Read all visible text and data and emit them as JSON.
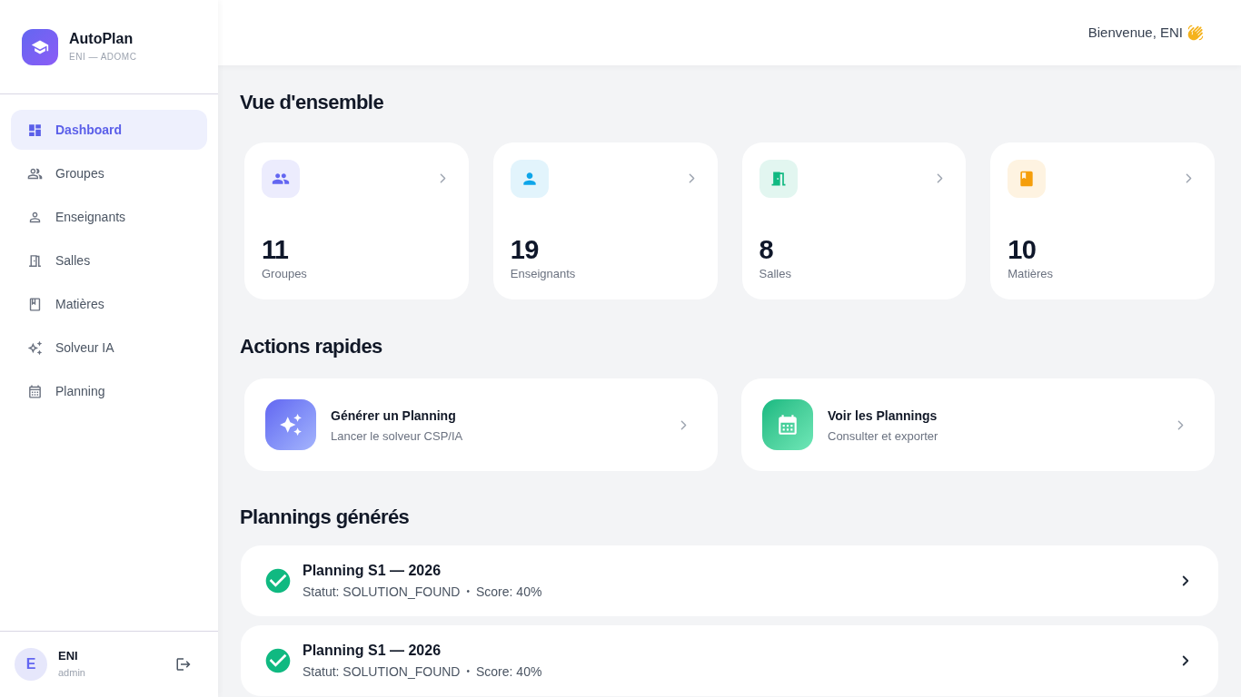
{
  "sidebar": {
    "brand": {
      "name": "AutoPlan",
      "subtitle": "ENI — ADOMC"
    },
    "nav_items": [
      {
        "label": "Dashboard",
        "selected": true
      },
      {
        "label": "Groupes",
        "selected": false
      },
      {
        "label": "Enseignants",
        "selected": false
      },
      {
        "label": "Salles",
        "selected": false
      },
      {
        "label": "Matières",
        "selected": false
      },
      {
        "label": "Solveur IA",
        "selected": false
      },
      {
        "label": "Planning",
        "selected": false
      }
    ],
    "user": {
      "initial": "E",
      "name": "ENI",
      "role": "admin"
    }
  },
  "header": {
    "greeting": "Bienvenue, ENI"
  },
  "overview": {
    "title": "Vue d'ensemble",
    "stats": [
      {
        "value": "11",
        "label": "Groupes",
        "color": "#6366f1"
      },
      {
        "value": "19",
        "label": "Enseignants",
        "color": "#0ea5e9"
      },
      {
        "value": "8",
        "label": "Salles",
        "color": "#10b981"
      },
      {
        "value": "10",
        "label": "Matières",
        "color": "#f59e0b"
      }
    ]
  },
  "quick_actions": {
    "title": "Actions rapides",
    "actions": [
      {
        "title": "Générer un Planning",
        "subtitle": "Lancer le solveur CSP/IA"
      },
      {
        "title": "Voir les Plannings",
        "subtitle": "Consulter et exporter"
      }
    ]
  },
  "generated_plannings": {
    "title": "Plannings générés",
    "items": [
      {
        "title": "Planning S1 — 2026",
        "status": "Statut: SOLUTION_FOUND",
        "separator": "•",
        "score": "Score: 40%"
      },
      {
        "title": "Planning S1 — 2026",
        "status": "Statut: SOLUTION_FOUND",
        "separator": "•",
        "score": "Score: 40%"
      }
    ]
  }
}
